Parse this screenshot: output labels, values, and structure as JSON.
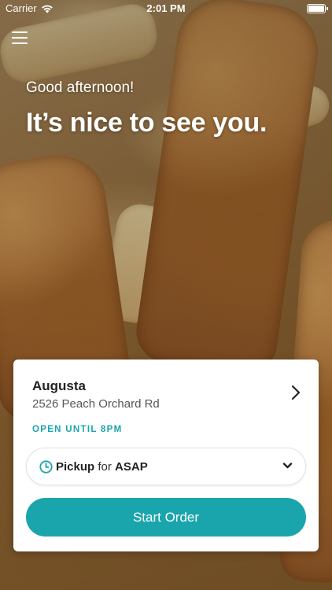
{
  "status_bar": {
    "carrier": "Carrier",
    "time": "2:01 PM",
    "icons": [
      "wifi-icon",
      "battery-icon"
    ]
  },
  "header": {
    "menu_icon": "hamburger-menu-icon",
    "greeting": "Good afternoon!",
    "headline": "It’s nice to see you."
  },
  "location": {
    "name": "Augusta",
    "address": "2526 Peach Orchard Rd",
    "hours": "OPEN UNTIL 8PM",
    "chevron_icon": "chevron-right-icon"
  },
  "order_mode": {
    "icon": "clock-icon",
    "mode": "Pickup",
    "connector": "for",
    "time": "ASAP",
    "dropdown_icon": "chevron-down-icon"
  },
  "actions": {
    "start_order_label": "Start Order"
  },
  "colors": {
    "accent": "#1aa5ad",
    "card_background": "#ffffff",
    "text_primary": "#222222",
    "text_secondary": "#555555"
  }
}
